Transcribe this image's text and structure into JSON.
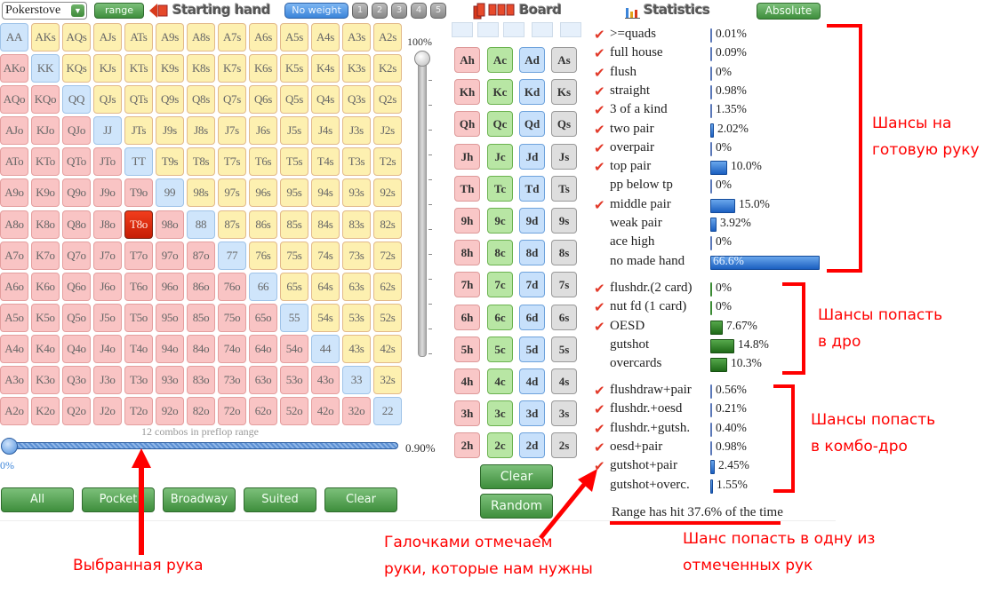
{
  "toolbar": {
    "engine_select": "Pokerstove",
    "range_button": "range",
    "starting_hand_title": "Starting hand",
    "weight_button": "No weight",
    "weight_levels": [
      "1",
      "2",
      "3",
      "4",
      "5"
    ]
  },
  "hand_grid": {
    "rows": [
      [
        "AA",
        "AKs",
        "AQs",
        "AJs",
        "ATs",
        "A9s",
        "A8s",
        "A7s",
        "A6s",
        "A5s",
        "A4s",
        "A3s",
        "A2s"
      ],
      [
        "AKo",
        "KK",
        "KQs",
        "KJs",
        "KTs",
        "K9s",
        "K8s",
        "K7s",
        "K6s",
        "K5s",
        "K4s",
        "K3s",
        "K2s"
      ],
      [
        "AQo",
        "KQo",
        "QQ",
        "QJs",
        "QTs",
        "Q9s",
        "Q8s",
        "Q7s",
        "Q6s",
        "Q5s",
        "Q4s",
        "Q3s",
        "Q2s"
      ],
      [
        "AJo",
        "KJo",
        "QJo",
        "JJ",
        "JTs",
        "J9s",
        "J8s",
        "J7s",
        "J6s",
        "J5s",
        "J4s",
        "J3s",
        "J2s"
      ],
      [
        "ATo",
        "KTo",
        "QTo",
        "JTo",
        "TT",
        "T9s",
        "T8s",
        "T7s",
        "T6s",
        "T5s",
        "T4s",
        "T3s",
        "T2s"
      ],
      [
        "A9o",
        "K9o",
        "Q9o",
        "J9o",
        "T9o",
        "99",
        "98s",
        "97s",
        "96s",
        "95s",
        "94s",
        "93s",
        "92s"
      ],
      [
        "A8o",
        "K8o",
        "Q8o",
        "J8o",
        "T8o",
        "98o",
        "88",
        "87s",
        "86s",
        "85s",
        "84s",
        "83s",
        "82s"
      ],
      [
        "A7o",
        "K7o",
        "Q7o",
        "J7o",
        "T7o",
        "97o",
        "87o",
        "77",
        "76s",
        "75s",
        "74s",
        "73s",
        "72s"
      ],
      [
        "A6o",
        "K6o",
        "Q6o",
        "J6o",
        "T6o",
        "96o",
        "86o",
        "76o",
        "66",
        "65s",
        "64s",
        "63s",
        "62s"
      ],
      [
        "A5o",
        "K5o",
        "Q5o",
        "J5o",
        "T5o",
        "95o",
        "85o",
        "75o",
        "65o",
        "55",
        "54s",
        "53s",
        "52s"
      ],
      [
        "A4o",
        "K4o",
        "Q4o",
        "J4o",
        "T4o",
        "94o",
        "84o",
        "74o",
        "64o",
        "54o",
        "44",
        "43s",
        "42s"
      ],
      [
        "A3o",
        "K3o",
        "Q3o",
        "J3o",
        "T3o",
        "93o",
        "83o",
        "73o",
        "63o",
        "53o",
        "43o",
        "33",
        "32s"
      ],
      [
        "A2o",
        "K2o",
        "Q2o",
        "J2o",
        "T2o",
        "92o",
        "82o",
        "72o",
        "62o",
        "52o",
        "42o",
        "32o",
        "22"
      ]
    ],
    "selected_hand": "T8o",
    "combos_text": "12 combos in preflop range"
  },
  "weight_slider": {
    "label": "100%",
    "value_percent": 100
  },
  "range_slider": {
    "min_label": "0%",
    "max_label": "0.90%",
    "value_percent": 0
  },
  "range_buttons": [
    "All",
    "Pocket",
    "Broadway",
    "Suited",
    "Clear"
  ],
  "board": {
    "title": "Board",
    "slots": 5,
    "ranks": [
      "A",
      "K",
      "Q",
      "J",
      "T",
      "9",
      "8",
      "7",
      "6",
      "5",
      "4",
      "3",
      "2"
    ],
    "suits": [
      "h",
      "c",
      "d",
      "s"
    ],
    "clear_button": "Clear",
    "random_button": "Random"
  },
  "statistics": {
    "title": "Statistics",
    "mode_button": "Absolute",
    "made_hands": [
      {
        "name": ">=quads",
        "value": "0.01%",
        "pct": 0.01,
        "checked": true
      },
      {
        "name": "full house",
        "value": "0.09%",
        "pct": 0.09,
        "checked": true
      },
      {
        "name": "flush",
        "value": "0%",
        "pct": 0,
        "checked": true
      },
      {
        "name": "straight",
        "value": "0.98%",
        "pct": 0.98,
        "checked": true
      },
      {
        "name": "3 of a kind",
        "value": "1.35%",
        "pct": 1.35,
        "checked": true
      },
      {
        "name": "two pair",
        "value": "2.02%",
        "pct": 2.02,
        "checked": true
      },
      {
        "name": "overpair",
        "value": "0%",
        "pct": 0,
        "checked": true
      },
      {
        "name": "top pair",
        "value": "10.0%",
        "pct": 10.0,
        "checked": true
      },
      {
        "name": "pp below tp",
        "value": "0%",
        "pct": 0,
        "checked": false
      },
      {
        "name": "middle pair",
        "value": "15.0%",
        "pct": 15.0,
        "checked": true
      },
      {
        "name": "weak pair",
        "value": "3.92%",
        "pct": 3.92,
        "checked": false
      },
      {
        "name": "ace high",
        "value": "0%",
        "pct": 0,
        "checked": false
      },
      {
        "name": "no made hand",
        "value": "66.6%",
        "pct": 66.6,
        "checked": false
      }
    ],
    "draws": [
      {
        "name": "flushdr.(2 card)",
        "value": "0%",
        "pct": 0,
        "checked": true
      },
      {
        "name": "nut fd (1 card)",
        "value": "0%",
        "pct": 0,
        "checked": true
      },
      {
        "name": "OESD",
        "value": "7.67%",
        "pct": 7.67,
        "checked": true
      },
      {
        "name": "gutshot",
        "value": "14.8%",
        "pct": 14.8,
        "checked": false
      },
      {
        "name": "overcards",
        "value": "10.3%",
        "pct": 10.3,
        "checked": false
      }
    ],
    "combo_draws": [
      {
        "name": "flushdraw+pair",
        "value": "0.56%",
        "pct": 0.56,
        "checked": true
      },
      {
        "name": "flushdr.+oesd",
        "value": "0.21%",
        "pct": 0.21,
        "checked": true
      },
      {
        "name": "flushdr.+gutsh.",
        "value": "0.40%",
        "pct": 0.4,
        "checked": true
      },
      {
        "name": "oesd+pair",
        "value": "0.98%",
        "pct": 0.98,
        "checked": true
      },
      {
        "name": "gutshot+pair",
        "value": "2.45%",
        "pct": 2.45,
        "checked": true
      },
      {
        "name": "gutshot+overc.",
        "value": "1.55%",
        "pct": 1.55,
        "checked": false
      }
    ],
    "range_hit_text": "Range has hit 37.6% of the time"
  },
  "annotations": {
    "made_hand": [
      "Шансы на",
      "готовую руку"
    ],
    "draw": [
      "Шансы попасть",
      "в дро"
    ],
    "combo_draw": [
      "Шансы попасть",
      "в комбо-дро"
    ],
    "checkmarks": [
      "Галочками отмечаем",
      "руки, которые нам нужны"
    ],
    "hit_chance": [
      "Шанс попасть в одну из",
      "отмеченных рук"
    ],
    "selected_hand": "Выбранная рука"
  },
  "colors": {
    "annotation_red": "#ff0000",
    "suited_cell": "#fdf0b0",
    "offsuit_cell": "#f9c4c4",
    "pair_cell": "#cfe5fb",
    "selected_cell": "#e22a0f",
    "made_hand_bar": "#1b5fc0",
    "draw_bar": "#1f6a18",
    "button_green": "#3e8e3c"
  }
}
